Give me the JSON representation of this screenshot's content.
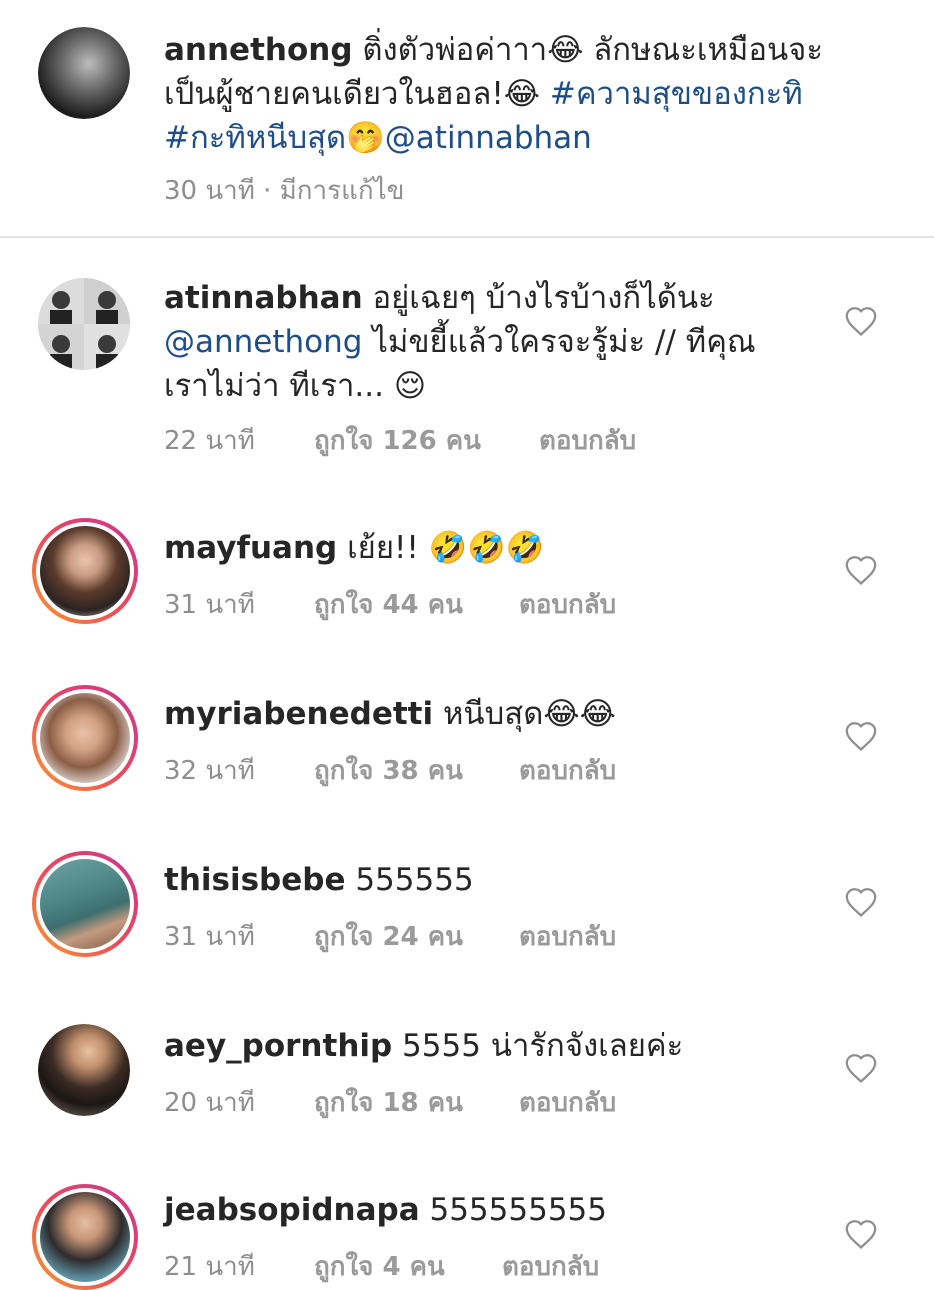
{
  "caption": {
    "username": "annethong",
    "text_line1": "ติ่งตัวพ่อค่าาา😂 ลักษณะเหมือนจะ",
    "text_line2a": "เป็นผู้ชายคนเดียวในฮอล!😂 ",
    "hashtag1": "#ความสุขของกะทิ",
    "hashtag2": "#กะทิหนีบสุด",
    "emoji_after_hashtag2": "🤭",
    "mention": "@atinnabhan",
    "meta": "30 นาที · มีการแก้ไข"
  },
  "comments": [
    {
      "username": "atinnabhan",
      "text_a": " อยู่เฉยๆ บ้างไรบ้างก็ได้นะ",
      "mention": "@annethong",
      "text_b": " ไม่ขยี้แล้วใครจะรู้ม่ะ // ทีคุณ",
      "text_c": "เราไม่ว่า ทีเรา... 😌",
      "time": "22 นาที",
      "likes": "ถูกใจ 126 คน",
      "reply": "ตอบกลับ"
    },
    {
      "username": "mayfuang",
      "text": " เย้ย!! 🤣🤣🤣",
      "time": "31 นาที",
      "likes": "ถูกใจ 44 คน",
      "reply": "ตอบกลับ"
    },
    {
      "username": "myriabenedetti",
      "text": " หนีบสุด😂😂",
      "time": "32 นาที",
      "likes": "ถูกใจ 38 คน",
      "reply": "ตอบกลับ"
    },
    {
      "username": "thisisbebe",
      "text": " 555555",
      "time": "31 นาที",
      "likes": "ถูกใจ 24 คน",
      "reply": "ตอบกลับ"
    },
    {
      "username": "aey_pornthip",
      "text": " 5555 น่ารักจังเลยค่ะ",
      "time": "20 นาที",
      "likes": "ถูกใจ 18 คน",
      "reply": "ตอบกลับ"
    },
    {
      "username": "jeabsopidnapa",
      "text": " 555555555",
      "time": "21 นาที",
      "likes": "ถูกใจ 4 คน",
      "reply": "ตอบกลับ"
    }
  ],
  "colors": {
    "link": "#1d4e89",
    "meta": "#8e8e8e",
    "story_ring": "#ee4a57"
  }
}
